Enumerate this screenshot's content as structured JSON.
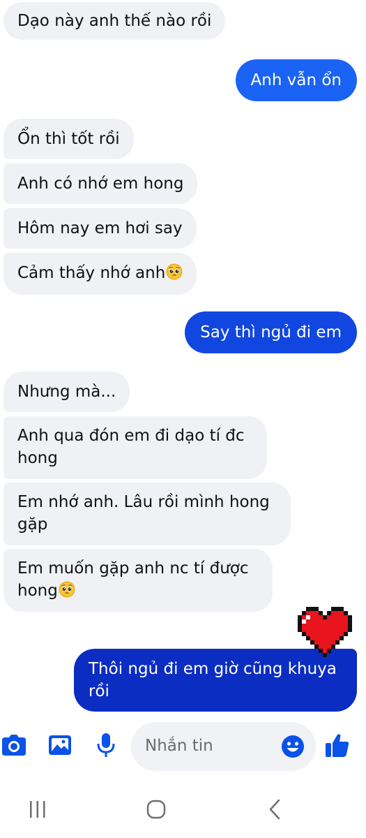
{
  "colors": {
    "incoming_bubble": "#f0f1f5",
    "outgoing_top": "#1565f5",
    "outgoing_bottom": "#0b2bbd",
    "accent": "#0a52e8",
    "heart": "#e8141e"
  },
  "messages": [
    {
      "side": "in",
      "text": "Dạo này anh thế nào rồi"
    },
    {
      "side": "out",
      "text": "Anh vẫn ổn"
    },
    {
      "side": "in",
      "text": "Ổn thì tốt rồi"
    },
    {
      "side": "in",
      "text": "Anh có nhớ em hong"
    },
    {
      "side": "in",
      "text": "Hôm nay em hơi say"
    },
    {
      "side": "in",
      "text": "Cảm thấy nhớ anh",
      "emoji": "pleading-face"
    },
    {
      "side": "out",
      "text": "Say thì ngủ đi em"
    },
    {
      "side": "in",
      "text": "Nhưng mà..."
    },
    {
      "side": "in",
      "text": "Anh qua đón em đi dạo tí đc hong"
    },
    {
      "side": "in",
      "text": "Em nhớ anh. Lâu rồi mình hong gặp"
    },
    {
      "side": "in",
      "text": "Em muốn gặp anh nc tí được hong",
      "emoji": "pleading-face"
    },
    {
      "side": "out",
      "text": "Thôi ngủ đi em giờ cũng khuya rồi",
      "reaction": "pixel-heart"
    }
  ],
  "composer": {
    "placeholder": "Nhắn tin",
    "icons": [
      "camera-icon",
      "gallery-icon",
      "microphone-icon",
      "emoji-icon",
      "thumbs-up-icon"
    ]
  },
  "system_nav": {
    "icons": [
      "recent-apps-icon",
      "home-icon",
      "back-icon"
    ]
  }
}
